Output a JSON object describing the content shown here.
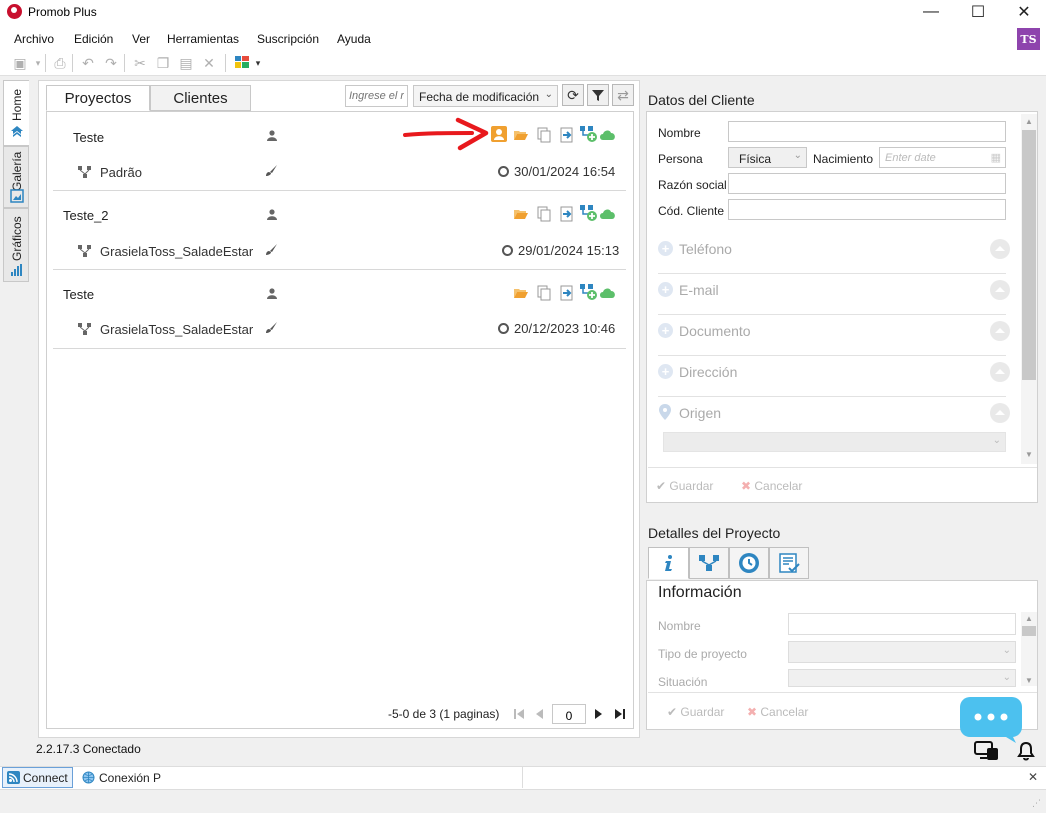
{
  "window": {
    "title": "Promob Plus",
    "minimize": "—",
    "maximize": "☐",
    "close": "✕"
  },
  "menu": [
    "Archivo",
    "Edición",
    "Ver",
    "Herramientas",
    "Suscripción",
    "Ayuda"
  ],
  "user": {
    "initials": "TS"
  },
  "sidetabs": [
    "Home",
    "Galería",
    "Gráficos"
  ],
  "projects": {
    "tabs": [
      "Proyectos",
      "Clientes"
    ],
    "search_placeholder": "Ingrese el r",
    "sort_value": "Fecha de modificación",
    "groups": [
      {
        "name": "Teste",
        "item": "Padrão",
        "date": "30/01/2024 16:54"
      },
      {
        "name": "Teste_2",
        "item": "GrasielaToss_SaladeEstar",
        "date": "29/01/2024 15:13"
      },
      {
        "name": "Teste",
        "item": "GrasielaToss_SaladeEstar",
        "date": "20/12/2023 10:46"
      }
    ],
    "pager_text": "-5-0 de 3 (1 paginas)",
    "pager_value": "0"
  },
  "client": {
    "title": "Datos del Cliente",
    "labels": {
      "nombre": "Nombre",
      "persona": "Persona",
      "persona_value": "Física",
      "nacimiento": "Nacimiento",
      "nacimiento_placeholder": "Enter date",
      "razon": "Razón social",
      "cod": "Cód. Cliente"
    },
    "sections": [
      "Teléfono",
      "E-mail",
      "Documento",
      "Dirección",
      "Origen"
    ],
    "save": "Guardar",
    "cancel": "Cancelar"
  },
  "details": {
    "title": "Detalles del Proyecto",
    "heading": "Información",
    "labels": [
      "Nombre",
      "Tipo de proyecto",
      "Situación"
    ],
    "save": "Guardar",
    "cancel": "Cancelar"
  },
  "status": {
    "version": "2.2.17.3",
    "state": "Conectado"
  },
  "bottom": {
    "connect": "Connect",
    "conexion": "Conexión P"
  },
  "colors": {
    "accent_orange": "#f0a030",
    "green": "#5cbf6a",
    "blue": "#2e86c1",
    "arrow": "#e8191d",
    "chat": "#4cc1ef",
    "badge": "#8e44ad"
  }
}
